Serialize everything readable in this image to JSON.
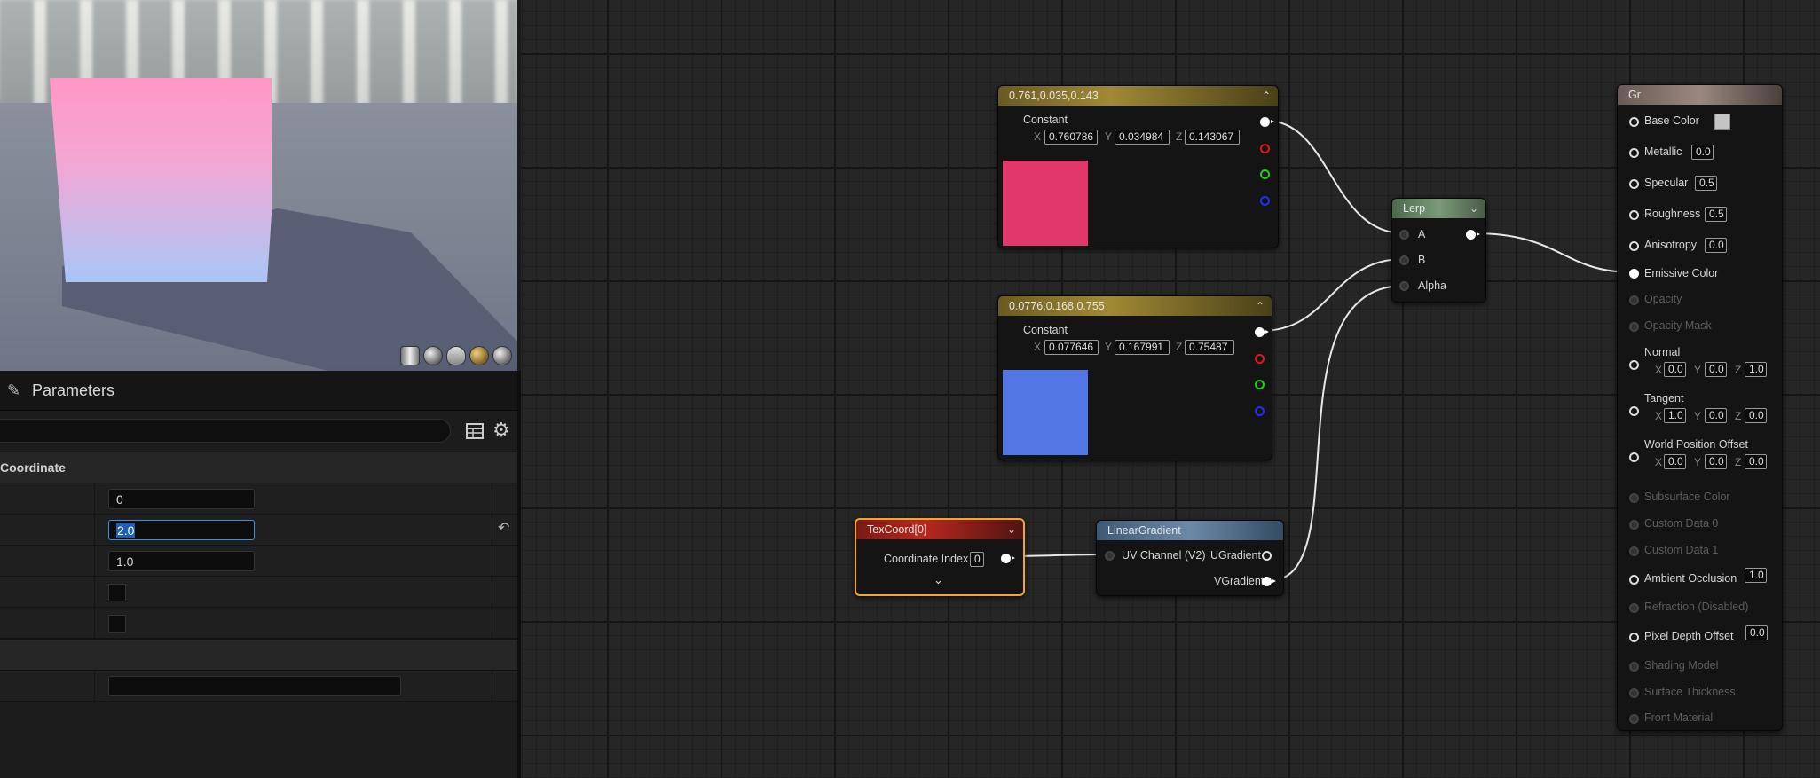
{
  "params_panel": {
    "title": "Parameters",
    "search": {
      "value": "",
      "placeholder": ""
    },
    "section_title": "Coordinate",
    "rows": [
      {
        "value": "0"
      },
      {
        "value": "2.0"
      },
      {
        "value": "1.0"
      }
    ],
    "bottom_row_value": ""
  },
  "nodes": {
    "constant1": {
      "title": "0.761,0.035,0.143",
      "label": "Constant",
      "x_axis": "X",
      "y_axis": "Y",
      "z_axis": "Z",
      "x": "0.760786",
      "y": "0.034984",
      "z": "0.143067",
      "color": "#e1376a"
    },
    "constant2": {
      "title": "0.0776,0.168,0.755",
      "label": "Constant",
      "x_axis": "X",
      "y_axis": "Y",
      "z_axis": "Z",
      "x": "0.077646",
      "y": "0.167991",
      "z": "0.75487",
      "color": "#5276e3"
    },
    "lerp": {
      "title": "Lerp",
      "pins": [
        "A",
        "B",
        "Alpha"
      ]
    },
    "texcoord": {
      "title": "TexCoord[0]",
      "label": "Coordinate Index",
      "value": "0"
    },
    "linear_gradient": {
      "title": "LinearGradient",
      "input": "UV Channel (V2)",
      "outputs": [
        "UGradient",
        "VGradient"
      ]
    },
    "material": {
      "title": "Gr",
      "base_color": "Base Color",
      "metallic": {
        "label": "Metallic",
        "value": "0.0"
      },
      "specular": {
        "label": "Specular",
        "value": "0.5"
      },
      "roughness": {
        "label": "Roughness",
        "value": "0.5"
      },
      "anisotropy": {
        "label": "Anisotropy",
        "value": "0.0"
      },
      "emissive": "Emissive Color",
      "opacity": "Opacity",
      "opacity_mask": "Opacity Mask",
      "normal": {
        "label": "Normal",
        "x": "0.0",
        "y": "0.0",
        "z": "1.0"
      },
      "tangent": {
        "label": "Tangent",
        "x": "1.0",
        "y": "0.0",
        "z": "0.0"
      },
      "wpo": {
        "label": "World Position Offset",
        "x": "0.0",
        "y": "0.0",
        "z": "0.0"
      },
      "axis_x": "X",
      "axis_y": "Y",
      "axis_z": "Z",
      "subsurface": "Subsurface Color",
      "custom0": "Custom Data 0",
      "custom1": "Custom Data 1",
      "ao": {
        "label": "Ambient Occlusion",
        "value": "1.0"
      },
      "refraction": "Refraction (Disabled)",
      "pdo": {
        "label": "Pixel Depth Offset",
        "value": "0.0"
      },
      "shading_model": "Shading Model",
      "surface_thickness": "Surface Thickness",
      "front_material": "Front Material"
    }
  },
  "colors": {
    "accent_selected": "#f5a623",
    "text_selection": "#1f5fb0"
  }
}
